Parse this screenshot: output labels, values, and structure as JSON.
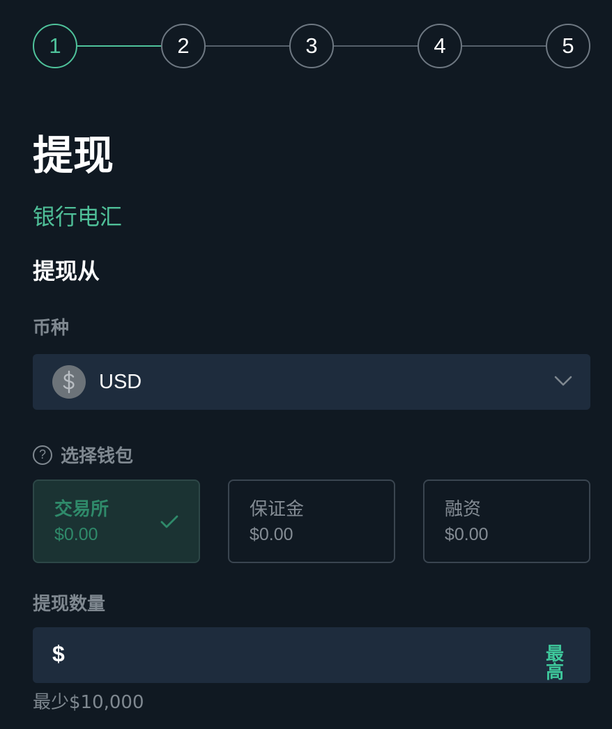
{
  "stepper": {
    "steps": [
      "1",
      "2",
      "3",
      "4",
      "5"
    ],
    "active_step": 1
  },
  "page": {
    "title": "提现",
    "method": "银行电汇",
    "from_label": "提现从"
  },
  "currency": {
    "label": "币种",
    "selected": "USD",
    "icon": "dollar-coin-icon"
  },
  "wallet": {
    "label": "选择钱包",
    "options": [
      {
        "name": "交易所",
        "amount": "$0.00",
        "selected": true
      },
      {
        "name": "保证金",
        "amount": "$0.00",
        "selected": false
      },
      {
        "name": "融资",
        "amount": "$0.00",
        "selected": false
      }
    ]
  },
  "amount": {
    "label": "提现数量",
    "prefix": "$",
    "value": "",
    "max_label": "最高",
    "min_note": "最少$10,000"
  },
  "colors": {
    "background": "#101922",
    "accent": "#4fc39b",
    "input_bg": "#1e2c3d",
    "selected_card_bg": "#1b3333"
  }
}
